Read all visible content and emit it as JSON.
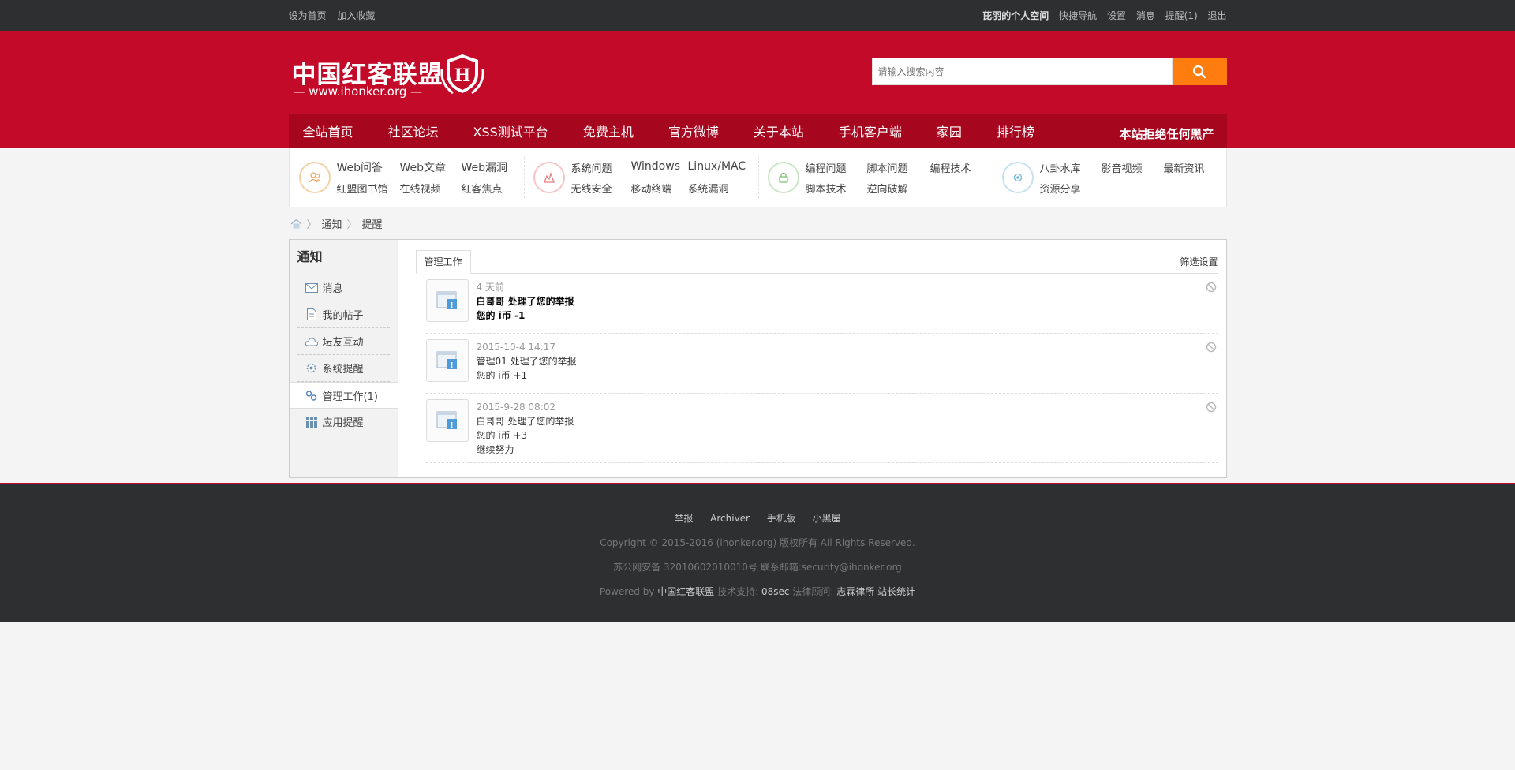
{
  "topbar": {
    "left": [
      "设为首页",
      "加入收藏"
    ],
    "username": "芘羽的个人空间",
    "right": [
      "快捷导航",
      "设置",
      "消息",
      "提醒(1)",
      "退出"
    ]
  },
  "header": {
    "logo_cn": "中国红客联盟",
    "logo_url": "— www.ihonker.org —",
    "logo_badge": "H",
    "search_placeholder": "请输入搜索内容",
    "search_icon": "search-icon",
    "accent": "#c30a28",
    "search_button_color": "#ff7d0e"
  },
  "nav": {
    "items": [
      "全站首页",
      "社区论坛",
      "XSS测试平台",
      "免费主机",
      "官方微博",
      "关于本站",
      "手机客户端",
      "家园",
      "排行榜"
    ],
    "slogan": "本站拒绝任何黑产"
  },
  "subnav": [
    {
      "icon": "users-icon",
      "color": "#f0c08a",
      "rows": [
        [
          "Web问答",
          "Web文章",
          "Web漏洞"
        ],
        [
          "红盟图书馆",
          "在线视频",
          "红客焦点"
        ]
      ]
    },
    {
      "icon": "fire-icon",
      "color": "#f2a6a6",
      "rows": [
        [
          "系统问题",
          "Windows",
          "Linux/MAC"
        ],
        [
          "无线安全",
          "移动终端",
          "系统漏洞"
        ]
      ]
    },
    {
      "icon": "code-icon",
      "color": "#a9d9a1",
      "rows": [
        [
          "编程问题",
          "脚本问题",
          "编程技术"
        ],
        [
          "脚本技术",
          "逆向破解",
          ""
        ]
      ]
    },
    {
      "icon": "gear-icon",
      "color": "#a7d3e8",
      "rows": [
        [
          "八卦水库",
          "影音视频",
          "最新资讯"
        ],
        [
          "资源分享",
          "",
          ""
        ]
      ]
    }
  ],
  "breadcrumb": {
    "home_icon": "home-icon",
    "items": [
      "通知",
      "提醒"
    ]
  },
  "sidebar": {
    "title": "通知",
    "items": [
      {
        "label": "消息",
        "icon": "mail-icon"
      },
      {
        "label": "我的帖子",
        "icon": "post-icon"
      },
      {
        "label": "坛友互动",
        "icon": "cloud-icon"
      },
      {
        "label": "系统提醒",
        "icon": "system-icon"
      },
      {
        "label": "管理工作(1)",
        "icon": "manage-icon",
        "active": true
      },
      {
        "label": "应用提醒",
        "icon": "app-icon"
      }
    ]
  },
  "content": {
    "tab": "管理工作",
    "filter": "筛选设置",
    "notices": [
      {
        "time": "4 天前",
        "lines": [
          "白哥哥 处理了您的举报",
          "您的 i币 -1"
        ],
        "unread": true
      },
      {
        "time": "2015-10-4 14:17",
        "lines": [
          "管理01 处理了您的举报",
          "您的 i币 +1"
        ],
        "unread": false
      },
      {
        "time": "2015-9-28 08:02",
        "lines": [
          "白哥哥 处理了您的举报",
          "您的 i币 +3",
          "继续努力"
        ],
        "unread": false
      }
    ]
  },
  "footer": {
    "links": [
      "举报",
      "Archiver",
      "手机版",
      "小黑屋"
    ],
    "copyright": "Copyright © 2015-2016 (ihonker.org) 版权所有 All Rights Reserved.",
    "icp": "苏公网安备 32010602010010号   联系邮箱:security@ihonker.org",
    "powered_prefix": "Powered by",
    "powered_name": "中国红客联盟",
    "tech_prefix": "技术支持:",
    "tech_name": "08sec",
    "legal_prefix": "法律顾问:",
    "legal_name": "志霖律所",
    "stats": "站长统计"
  }
}
